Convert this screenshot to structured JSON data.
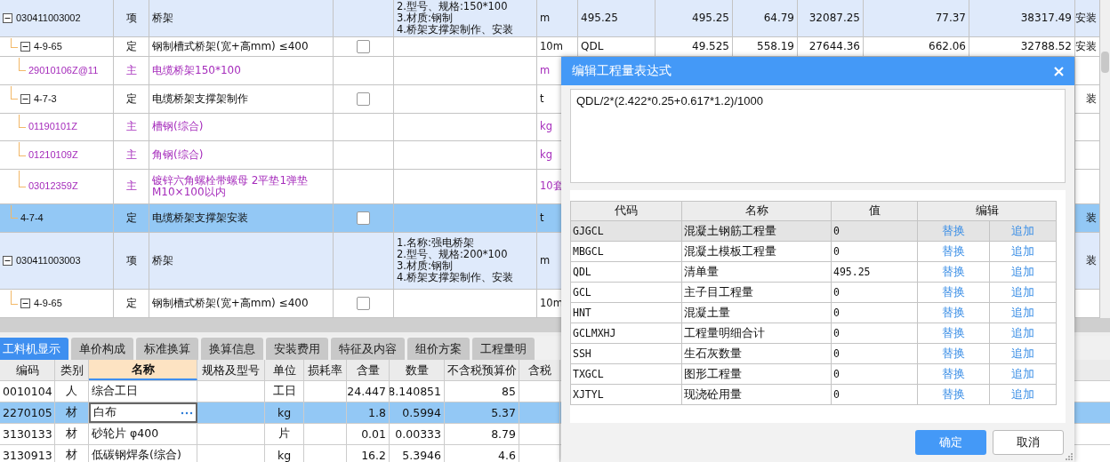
{
  "bill_table": {
    "rows": [
      {
        "code": "030411003002",
        "type": "项",
        "kind": "item",
        "name": "桥架",
        "features": [
          "2.型号、规格:150*100",
          "3.材质:钢制",
          "4.桥架支撑架制作、安装"
        ],
        "unit": "m",
        "expression": "495.25",
        "quantity": "495.25",
        "unit_price": "64.79",
        "total": "32087.25",
        "column_11": "77.37",
        "column_12": "38317.49",
        "column_13": "安装",
        "selected": false,
        "expanded": true,
        "children": [
          {
            "code": "4-9-65",
            "type": "定",
            "kind": "quota",
            "name": "钢制槽式桥架(宽+高mm) ≤400",
            "checked": false,
            "unit": "10m",
            "expression": "QDL",
            "quantity": "49.525",
            "unit_price": "558.19",
            "total": "27644.36",
            "column_11": "662.06",
            "column_12": "32788.52",
            "column_13": "安装",
            "selected": false,
            "expanded": true,
            "children": [
              {
                "code": "29010106Z@11",
                "type": "主",
                "kind": "material",
                "name": "电缆桥架150*100",
                "unit": "m",
                "selected": false
              }
            ]
          },
          {
            "code": "4-7-3",
            "type": "定",
            "kind": "quota",
            "name": "电缆桥架支撑架制作",
            "checked": false,
            "unit": "t",
            "column_13": "装",
            "selected": false,
            "expanded": true,
            "children": [
              {
                "code": "01190101Z",
                "type": "主",
                "kind": "material",
                "name": "槽钢(综合)",
                "unit": "kg",
                "selected": false
              },
              {
                "code": "01210109Z",
                "type": "主",
                "kind": "material",
                "name": "角钢(综合)",
                "unit": "kg",
                "selected": false
              },
              {
                "code": "03012359Z",
                "type": "主",
                "kind": "material",
                "name": "镀锌六角螺栓带螺母  2平垫1弹垫 M10×100以内",
                "unit": "10套",
                "selected": false
              }
            ]
          },
          {
            "code": "4-7-4",
            "type": "定",
            "kind": "quota",
            "name": "电缆桥架支撑架安装",
            "checked": false,
            "unit": "t",
            "column_13": "装",
            "selected": true
          }
        ]
      },
      {
        "code": "030411003003",
        "type": "项",
        "kind": "item",
        "name": "桥架",
        "features": [
          "1.名称:强电桥架",
          "2.型号、规格:200*100",
          "3.材质:钢制",
          "4.桥架支撑架制作、安装"
        ],
        "unit": "m",
        "column_13": "装",
        "selected": false,
        "expanded": true,
        "children": [
          {
            "code": "4-9-65",
            "type": "定",
            "kind": "quota",
            "name": "钢制槽式桥架(宽+高mm) ≤400",
            "checked": false,
            "unit": "10m",
            "selected": false,
            "expanded": true
          }
        ]
      }
    ]
  },
  "detail_tabs": [
    {
      "label": "工料机显示",
      "selected": true
    },
    {
      "label": "单价构成",
      "selected": false
    },
    {
      "label": "标准换算",
      "selected": false
    },
    {
      "label": "换算信息",
      "selected": false
    },
    {
      "label": "安装费用",
      "selected": false
    },
    {
      "label": "特征及内容",
      "selected": false
    },
    {
      "label": "组价方案",
      "selected": false
    },
    {
      "label": "工程量明",
      "selected": false
    }
  ],
  "detail_table": {
    "columns": [
      {
        "label": "编码",
        "selected": false
      },
      {
        "label": "类别",
        "selected": false
      },
      {
        "label": "名称",
        "selected": true
      },
      {
        "label": "规格及型号",
        "selected": false
      },
      {
        "label": "单位",
        "selected": false
      },
      {
        "label": "损耗率",
        "selected": false
      },
      {
        "label": "含量",
        "selected": false
      },
      {
        "label": "数量",
        "selected": false
      },
      {
        "label": "不含税预算价",
        "selected": false
      },
      {
        "label": "含税",
        "selected": false
      }
    ],
    "rows": [
      {
        "code": "0010104",
        "category": "人",
        "name": "综合工日",
        "unit": "工日",
        "content": "24.447",
        "quantity": "8.140851",
        "price": "85",
        "selected": false,
        "editing": false
      },
      {
        "code": "2270105",
        "category": "材",
        "name": "白布",
        "unit": "kg",
        "content": "1.8",
        "quantity": "0.5994",
        "price": "5.37",
        "selected": true,
        "editing": true
      },
      {
        "code": "3130133",
        "category": "材",
        "name": "砂轮片 φ400",
        "unit": "片",
        "content": "0.01",
        "quantity": "0.00333",
        "price": "8.79",
        "selected": false,
        "editing": false
      },
      {
        "code": "3130913",
        "category": "材",
        "name": "低碳钢焊条(综合)",
        "unit": "kg",
        "content": "16.2",
        "quantity": "5.3946",
        "price": "4.6",
        "selected": false,
        "editing": false
      }
    ]
  },
  "dialog": {
    "title": "编辑工程量表达式",
    "expression": "QDL/2*(2.422*0.25+0.617*1.2)/1000",
    "variables": {
      "columns": [
        "代码",
        "名称",
        "值",
        "编辑"
      ],
      "rows": [
        {
          "code": "GJGCL",
          "name": "混凝土钢筋工程量",
          "value": "0",
          "actions": [
            "替换",
            "追加"
          ],
          "selected": true
        },
        {
          "code": "MBGCL",
          "name": "混凝土模板工程量",
          "value": "0",
          "actions": [
            "替换",
            "追加"
          ],
          "selected": false
        },
        {
          "code": "QDL",
          "name": "清单量",
          "value": "495.25",
          "actions": [
            "替换",
            "追加"
          ],
          "selected": false
        },
        {
          "code": "GCL",
          "name": "主子目工程量",
          "value": "0",
          "actions": [
            "替换",
            "追加"
          ],
          "selected": false
        },
        {
          "code": "HNT",
          "name": "混凝土量",
          "value": "0",
          "actions": [
            "替换",
            "追加"
          ],
          "selected": false
        },
        {
          "code": "GCLMXHJ",
          "name": "工程量明细合计",
          "value": "0",
          "actions": [
            "替换",
            "追加"
          ],
          "selected": false
        },
        {
          "code": "SSH",
          "name": "生石灰数量",
          "value": "0",
          "actions": [
            "替换",
            "追加"
          ],
          "selected": false
        },
        {
          "code": "TXGCL",
          "name": "图形工程量",
          "value": "0",
          "actions": [
            "替换",
            "追加"
          ],
          "selected": false
        },
        {
          "code": "XJTYL",
          "name": "现浇砼用量",
          "value": "0",
          "actions": [
            "替换",
            "追加"
          ],
          "selected": false
        }
      ]
    },
    "buttons": [
      {
        "label": "确定",
        "kind": "primary"
      },
      {
        "label": "取消",
        "kind": "secondary"
      }
    ]
  }
}
